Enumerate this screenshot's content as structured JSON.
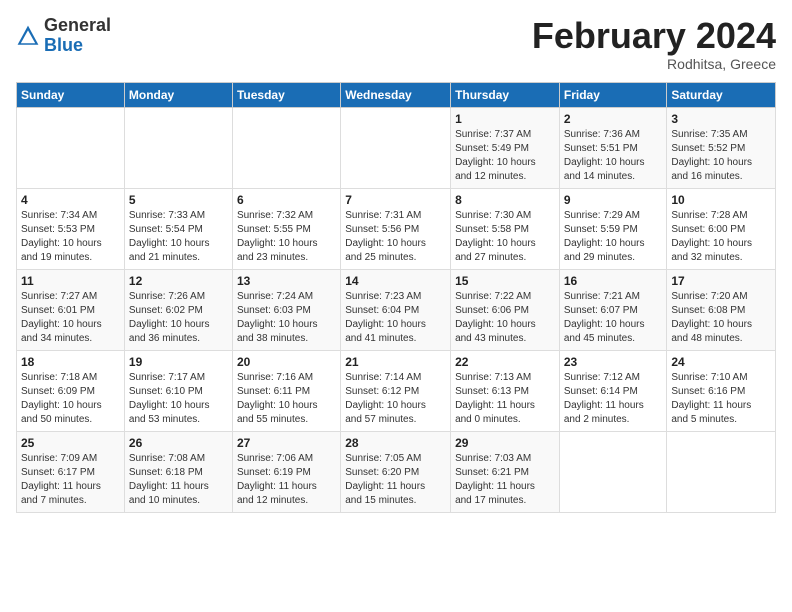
{
  "header": {
    "logo_general": "General",
    "logo_blue": "Blue",
    "month_title": "February 2024",
    "subtitle": "Rodhitsa, Greece"
  },
  "weekdays": [
    "Sunday",
    "Monday",
    "Tuesday",
    "Wednesday",
    "Thursday",
    "Friday",
    "Saturday"
  ],
  "weeks": [
    [
      {
        "day": "",
        "info": ""
      },
      {
        "day": "",
        "info": ""
      },
      {
        "day": "",
        "info": ""
      },
      {
        "day": "",
        "info": ""
      },
      {
        "day": "1",
        "info": "Sunrise: 7:37 AM\nSunset: 5:49 PM\nDaylight: 10 hours\nand 12 minutes."
      },
      {
        "day": "2",
        "info": "Sunrise: 7:36 AM\nSunset: 5:51 PM\nDaylight: 10 hours\nand 14 minutes."
      },
      {
        "day": "3",
        "info": "Sunrise: 7:35 AM\nSunset: 5:52 PM\nDaylight: 10 hours\nand 16 minutes."
      }
    ],
    [
      {
        "day": "4",
        "info": "Sunrise: 7:34 AM\nSunset: 5:53 PM\nDaylight: 10 hours\nand 19 minutes."
      },
      {
        "day": "5",
        "info": "Sunrise: 7:33 AM\nSunset: 5:54 PM\nDaylight: 10 hours\nand 21 minutes."
      },
      {
        "day": "6",
        "info": "Sunrise: 7:32 AM\nSunset: 5:55 PM\nDaylight: 10 hours\nand 23 minutes."
      },
      {
        "day": "7",
        "info": "Sunrise: 7:31 AM\nSunset: 5:56 PM\nDaylight: 10 hours\nand 25 minutes."
      },
      {
        "day": "8",
        "info": "Sunrise: 7:30 AM\nSunset: 5:58 PM\nDaylight: 10 hours\nand 27 minutes."
      },
      {
        "day": "9",
        "info": "Sunrise: 7:29 AM\nSunset: 5:59 PM\nDaylight: 10 hours\nand 29 minutes."
      },
      {
        "day": "10",
        "info": "Sunrise: 7:28 AM\nSunset: 6:00 PM\nDaylight: 10 hours\nand 32 minutes."
      }
    ],
    [
      {
        "day": "11",
        "info": "Sunrise: 7:27 AM\nSunset: 6:01 PM\nDaylight: 10 hours\nand 34 minutes."
      },
      {
        "day": "12",
        "info": "Sunrise: 7:26 AM\nSunset: 6:02 PM\nDaylight: 10 hours\nand 36 minutes."
      },
      {
        "day": "13",
        "info": "Sunrise: 7:24 AM\nSunset: 6:03 PM\nDaylight: 10 hours\nand 38 minutes."
      },
      {
        "day": "14",
        "info": "Sunrise: 7:23 AM\nSunset: 6:04 PM\nDaylight: 10 hours\nand 41 minutes."
      },
      {
        "day": "15",
        "info": "Sunrise: 7:22 AM\nSunset: 6:06 PM\nDaylight: 10 hours\nand 43 minutes."
      },
      {
        "day": "16",
        "info": "Sunrise: 7:21 AM\nSunset: 6:07 PM\nDaylight: 10 hours\nand 45 minutes."
      },
      {
        "day": "17",
        "info": "Sunrise: 7:20 AM\nSunset: 6:08 PM\nDaylight: 10 hours\nand 48 minutes."
      }
    ],
    [
      {
        "day": "18",
        "info": "Sunrise: 7:18 AM\nSunset: 6:09 PM\nDaylight: 10 hours\nand 50 minutes."
      },
      {
        "day": "19",
        "info": "Sunrise: 7:17 AM\nSunset: 6:10 PM\nDaylight: 10 hours\nand 53 minutes."
      },
      {
        "day": "20",
        "info": "Sunrise: 7:16 AM\nSunset: 6:11 PM\nDaylight: 10 hours\nand 55 minutes."
      },
      {
        "day": "21",
        "info": "Sunrise: 7:14 AM\nSunset: 6:12 PM\nDaylight: 10 hours\nand 57 minutes."
      },
      {
        "day": "22",
        "info": "Sunrise: 7:13 AM\nSunset: 6:13 PM\nDaylight: 11 hours\nand 0 minutes."
      },
      {
        "day": "23",
        "info": "Sunrise: 7:12 AM\nSunset: 6:14 PM\nDaylight: 11 hours\nand 2 minutes."
      },
      {
        "day": "24",
        "info": "Sunrise: 7:10 AM\nSunset: 6:16 PM\nDaylight: 11 hours\nand 5 minutes."
      }
    ],
    [
      {
        "day": "25",
        "info": "Sunrise: 7:09 AM\nSunset: 6:17 PM\nDaylight: 11 hours\nand 7 minutes."
      },
      {
        "day": "26",
        "info": "Sunrise: 7:08 AM\nSunset: 6:18 PM\nDaylight: 11 hours\nand 10 minutes."
      },
      {
        "day": "27",
        "info": "Sunrise: 7:06 AM\nSunset: 6:19 PM\nDaylight: 11 hours\nand 12 minutes."
      },
      {
        "day": "28",
        "info": "Sunrise: 7:05 AM\nSunset: 6:20 PM\nDaylight: 11 hours\nand 15 minutes."
      },
      {
        "day": "29",
        "info": "Sunrise: 7:03 AM\nSunset: 6:21 PM\nDaylight: 11 hours\nand 17 minutes."
      },
      {
        "day": "",
        "info": ""
      },
      {
        "day": "",
        "info": ""
      }
    ]
  ]
}
